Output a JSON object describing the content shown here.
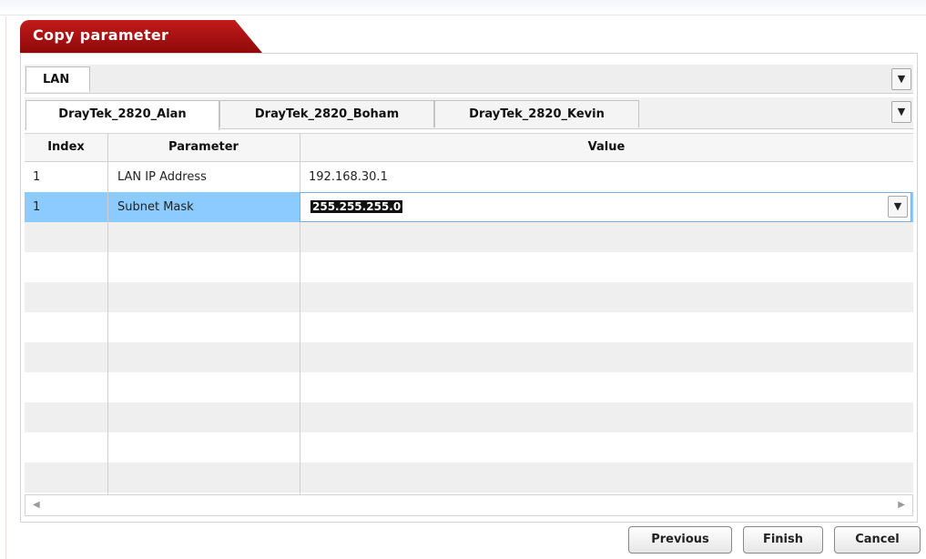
{
  "dialog": {
    "title": "Copy parameter"
  },
  "category": {
    "selected_tab": "LAN"
  },
  "device_tabs": [
    {
      "label": "DrayTek_2820_Alan",
      "active": true
    },
    {
      "label": "DrayTek_2820_Boham",
      "active": false
    },
    {
      "label": "DrayTek_2820_Kevin",
      "active": false
    }
  ],
  "table": {
    "columns": [
      "Index",
      "Parameter",
      "Value"
    ],
    "rows": [
      {
        "index": "1",
        "parameter": "LAN IP Address",
        "value": "192.168.30.1",
        "selected": false
      },
      {
        "index": "1",
        "parameter": "Subnet Mask",
        "value": "255.255.255.0",
        "selected": true
      }
    ]
  },
  "icons": {
    "dropdown": "chevron-down-icon",
    "scroll_left": "scroll-left-arrow-icon",
    "scroll_right": "scroll-right-arrow-icon"
  },
  "buttons": {
    "previous": "Previous",
    "finish": "Finish",
    "cancel": "Cancel"
  },
  "colors": {
    "title_bar": "#b3121a",
    "selected_row": "#8ccbff",
    "input_border": "#7aaee0"
  }
}
